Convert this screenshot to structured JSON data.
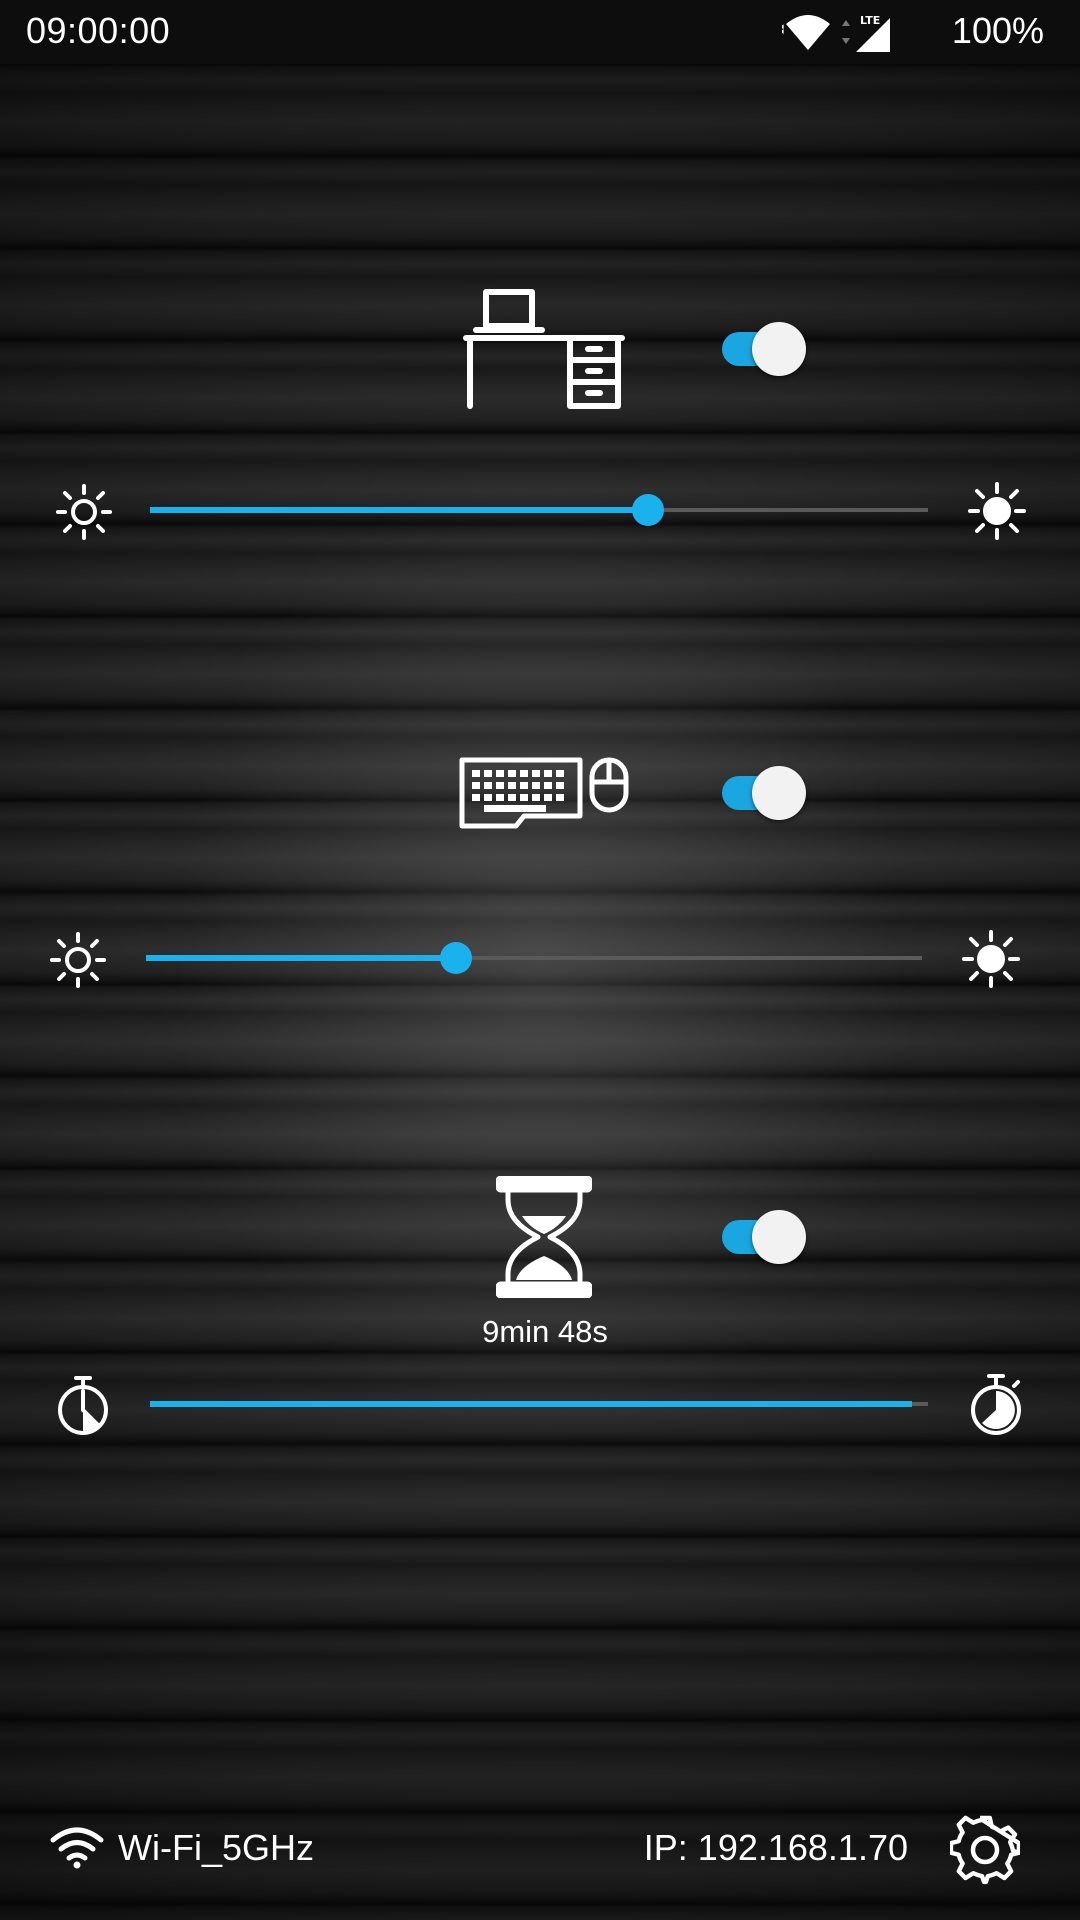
{
  "status_bar": {
    "time": "09:00:00",
    "lte_label": "LTE",
    "battery": "100%"
  },
  "desk_light": {
    "icon": "desk-icon",
    "enabled": true,
    "brightness_percent": 64
  },
  "keyboard_light": {
    "icon": "keyboard-mouse-icon",
    "enabled": true,
    "brightness_percent": 40
  },
  "timer": {
    "icon": "hourglass-icon",
    "enabled": true,
    "remaining": "9min 48s",
    "slider_percent": 98
  },
  "footer": {
    "wifi_name": "Wi-Fi_5GHz",
    "ip": "IP: 192.168.1.70"
  },
  "colors": {
    "accent": "#1ab2ec",
    "toggle_track": "#1aa6e0",
    "rail": "#5a5a5a"
  }
}
